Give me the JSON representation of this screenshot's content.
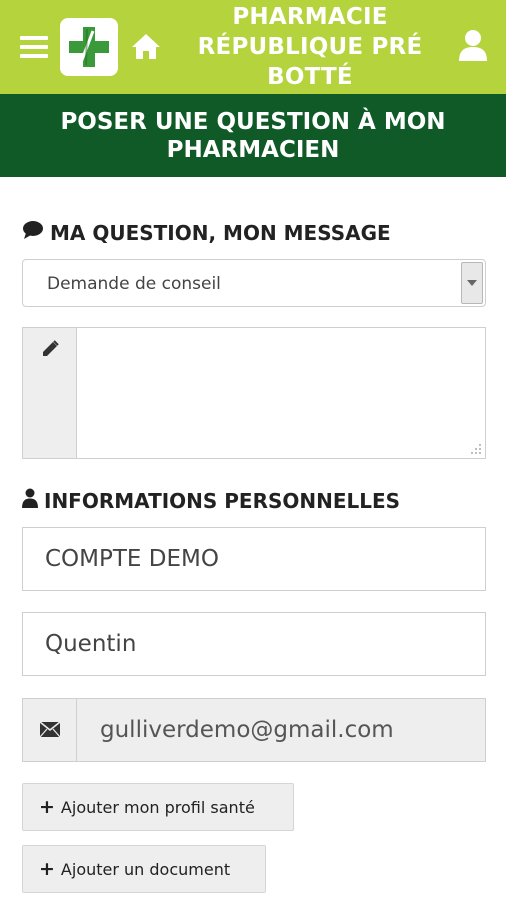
{
  "header": {
    "title": "PHARMACIE RÉPUBLIQUE PRÉ BOTTÉ",
    "menu_icon": "hamburger-icon",
    "home_icon": "home-icon",
    "user_icon": "user-icon",
    "logo_icon": "pharmacy-cross-logo",
    "colors": {
      "bar": "#b5d33c",
      "logo_cross": "#3a9a3a"
    }
  },
  "banner": {
    "title": "POSER UNE QUESTION À MON PHARMACIEN",
    "color": "#0f5a27"
  },
  "question_section": {
    "title": "MA QUESTION, MON MESSAGE",
    "icon": "comment-icon",
    "type_select": {
      "value": "Demande de conseil"
    },
    "message": {
      "value": "",
      "icon": "pencil-icon"
    }
  },
  "personal_section": {
    "title": "INFORMATIONS PERSONNELLES",
    "icon": "user-icon",
    "last_name": {
      "value": "COMPTE DEMO"
    },
    "first_name": {
      "value": "Quentin"
    },
    "email": {
      "value": "gulliverdemo@gmail.com",
      "icon": "envelope-icon"
    }
  },
  "actions": {
    "add_health_profile": "Ajouter mon profil santé",
    "add_document": "Ajouter un document",
    "plus_symbol": "+"
  }
}
